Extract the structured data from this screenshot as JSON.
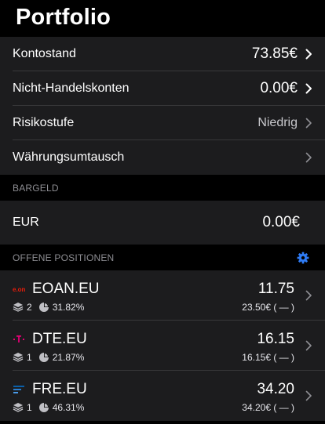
{
  "header": {
    "title": "Portfolio"
  },
  "account": {
    "items": [
      {
        "label": "Kontostand",
        "value": "73.85€"
      },
      {
        "label": "Nicht-Handelskonten",
        "value": "0.00€"
      },
      {
        "label": "Risikostufe",
        "value": "Niedrig"
      },
      {
        "label": "Währungsumtausch",
        "value": ""
      }
    ]
  },
  "cash": {
    "section_title": "BARGELD",
    "currency": "EUR",
    "amount": "0.00€"
  },
  "positions": {
    "section_title": "OFFENE POSITIONEN",
    "items": [
      {
        "symbol": "EOAN.EU",
        "quantity": "2",
        "allocation": "31.82%",
        "price": "11.75",
        "value": "23.50€ ( — )",
        "logo_icon": "eon-logo-icon",
        "logo_color": "#ea1c0a"
      },
      {
        "symbol": "DTE.EU",
        "quantity": "1",
        "allocation": "21.87%",
        "price": "16.15",
        "value": "16.15€ ( — )",
        "logo_icon": "telekom-logo-icon",
        "logo_color": "#e20074"
      },
      {
        "symbol": "FRE.EU",
        "quantity": "1",
        "allocation": "46.31%",
        "price": "34.20",
        "value": "34.20€ ( — )",
        "logo_icon": "fresenius-logo-icon",
        "logo_color": "#0a5fa8"
      }
    ]
  },
  "colors": {
    "accent": "#2f7cf6",
    "background": "#000000",
    "cell": "#1c1c1e",
    "separator": "#38383a"
  }
}
